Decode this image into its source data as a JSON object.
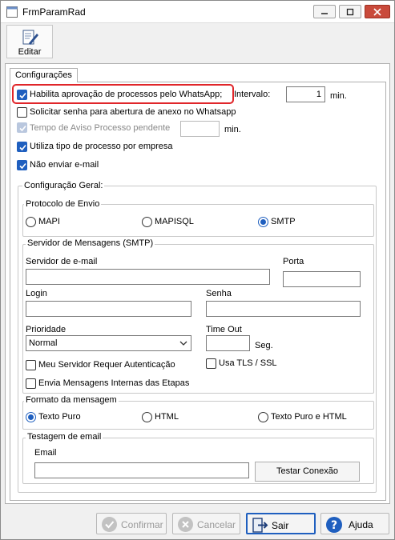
{
  "window": {
    "title": "FrmParamRad"
  },
  "toolbar": {
    "edit_label": "Editar"
  },
  "tabs": {
    "active": "Configurações"
  },
  "options": {
    "whatsapp_approval": {
      "label": "Habilita aprovação de processos pelo WhatsApp;",
      "checked": true
    },
    "interval_label": "Intervalo:",
    "interval_value": "1",
    "interval_unit": "min.",
    "request_password": {
      "label": "Solicitar senha para abertura de anexo no Whatsapp",
      "checked": false
    },
    "warn_time": {
      "label": "Tempo de Aviso Processo pendente",
      "checked": true,
      "disabled": true
    },
    "warn_time_value": "",
    "warn_time_unit": "min.",
    "process_type": {
      "label": "Utiliza tipo de processo por empresa",
      "checked": true
    },
    "no_email": {
      "label": "Não enviar e-mail",
      "checked": true
    }
  },
  "general": {
    "title": "Configuração Geral:",
    "protocol": {
      "title": "Protocolo de Envio",
      "options": [
        "MAPI",
        "MAPISQL",
        "SMTP"
      ],
      "selected": "SMTP"
    },
    "smtp": {
      "title": "Servidor de Mensagens (SMTP)",
      "server_label": "Servidor de e-mail",
      "server_value": "",
      "port_label": "Porta",
      "port_value": "",
      "login_label": "Login",
      "login_value": "",
      "password_label": "Senha",
      "password_value": "",
      "priority_label": "Prioridade",
      "priority_value": "Normal",
      "timeout_label": "Time Out",
      "timeout_value": "",
      "timeout_unit": "Seg.",
      "auth_label": "Meu Servidor Requer Autenticação",
      "auth_checked": false,
      "tls_label": "Usa TLS / SSL",
      "tls_checked": false,
      "internal_label": "Envia Mensagens Internas das Etapas",
      "internal_checked": false
    },
    "format": {
      "title": "Formato da mensagem",
      "options": [
        "Texto Puro",
        "HTML",
        "Texto Puro e HTML"
      ],
      "selected": "Texto Puro"
    },
    "test": {
      "title": "Testagem de email",
      "email_label": "Email",
      "email_value": "",
      "button_label": "Testar Conexão"
    }
  },
  "footer": {
    "confirm_label": "Confirmar",
    "cancel_label": "Cancelar",
    "exit_label": "Sair",
    "help_label": "Ajuda"
  },
  "colors": {
    "accent": "#1f5fbf",
    "highlight": "#e0262a"
  }
}
